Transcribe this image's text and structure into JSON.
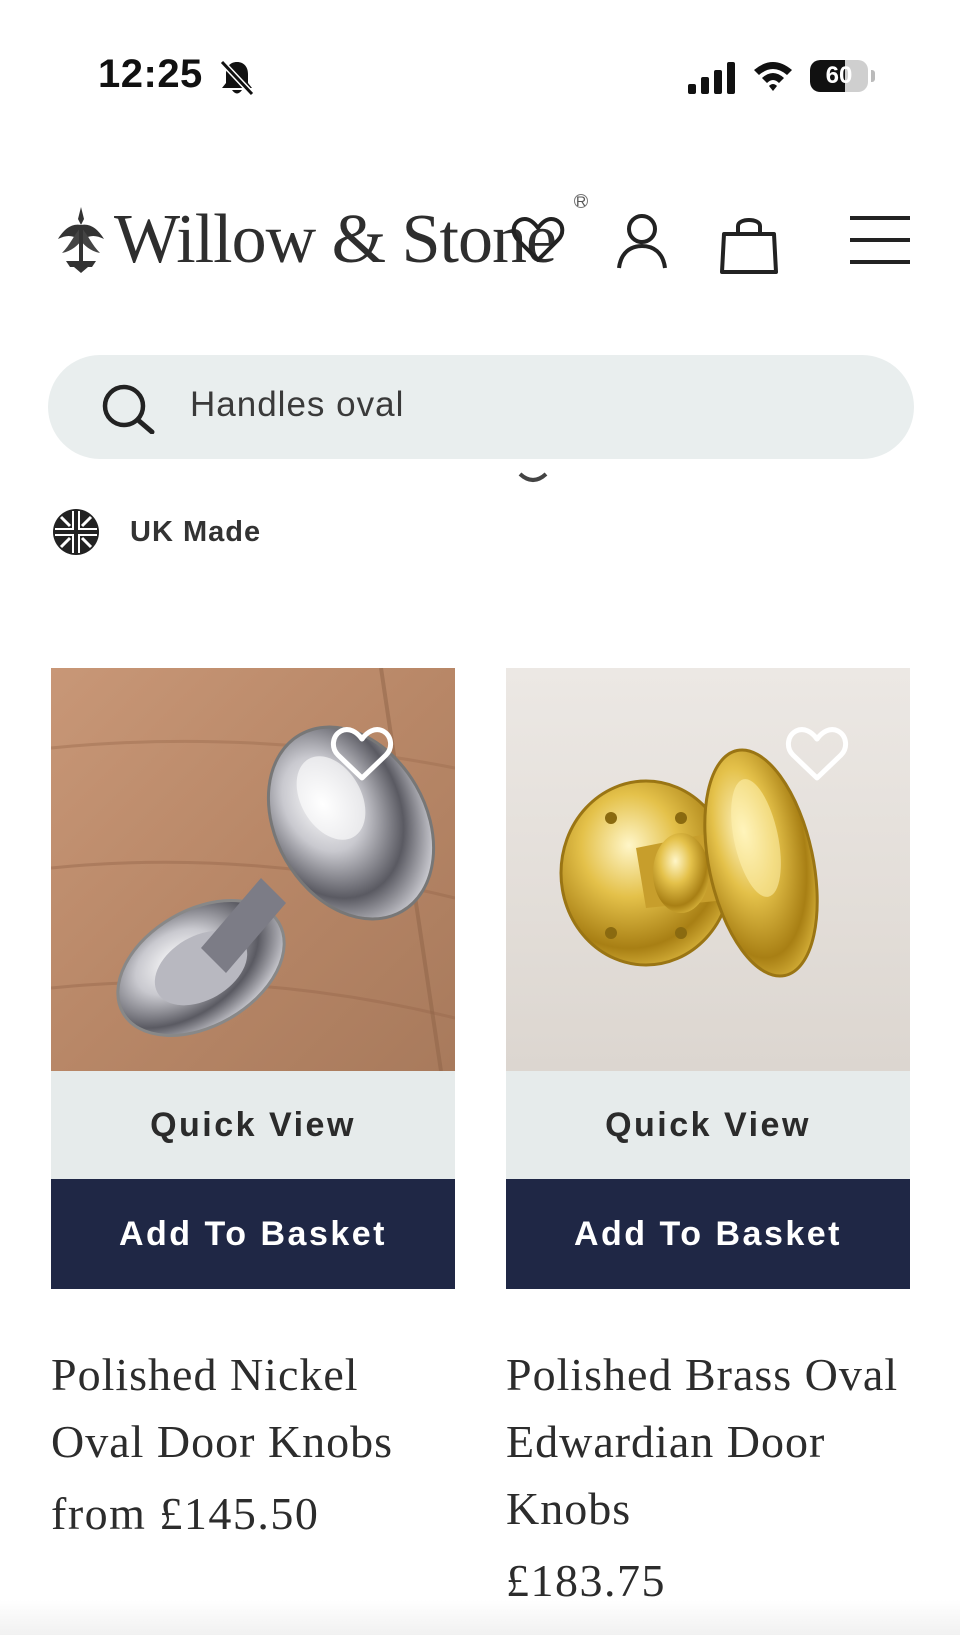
{
  "status_bar": {
    "time": "12:25",
    "battery_level": "60",
    "icons": [
      "bell-slash-icon",
      "signal-icon",
      "wifi-icon",
      "battery-icon"
    ]
  },
  "header": {
    "logo_text": "Willow & Stone",
    "icons": [
      "wishlist-heart-icon",
      "account-icon",
      "shopping-bag-icon",
      "menu-icon"
    ]
  },
  "search": {
    "value": "Handles oval",
    "icon": "search-icon"
  },
  "badge": {
    "label": "UK Made",
    "icon": "union-jack-icon"
  },
  "products": [
    {
      "name": "Polished Nickel Oval Door Knobs",
      "price": "from £145.50",
      "quick_view": "Quick View",
      "add_to_basket": "Add To Basket",
      "image": "polished-nickel-oval-knob-image"
    },
    {
      "name": "Polished Brass Oval Edwardian Door Knobs",
      "price": "£183.75",
      "quick_view": "Quick View",
      "add_to_basket": "Add To Basket",
      "image": "polished-brass-oval-knob-image"
    }
  ],
  "colors": {
    "accent": "#1f2745",
    "quick_view_bg": "#e6ebeb",
    "search_bg": "#e9eeee"
  }
}
